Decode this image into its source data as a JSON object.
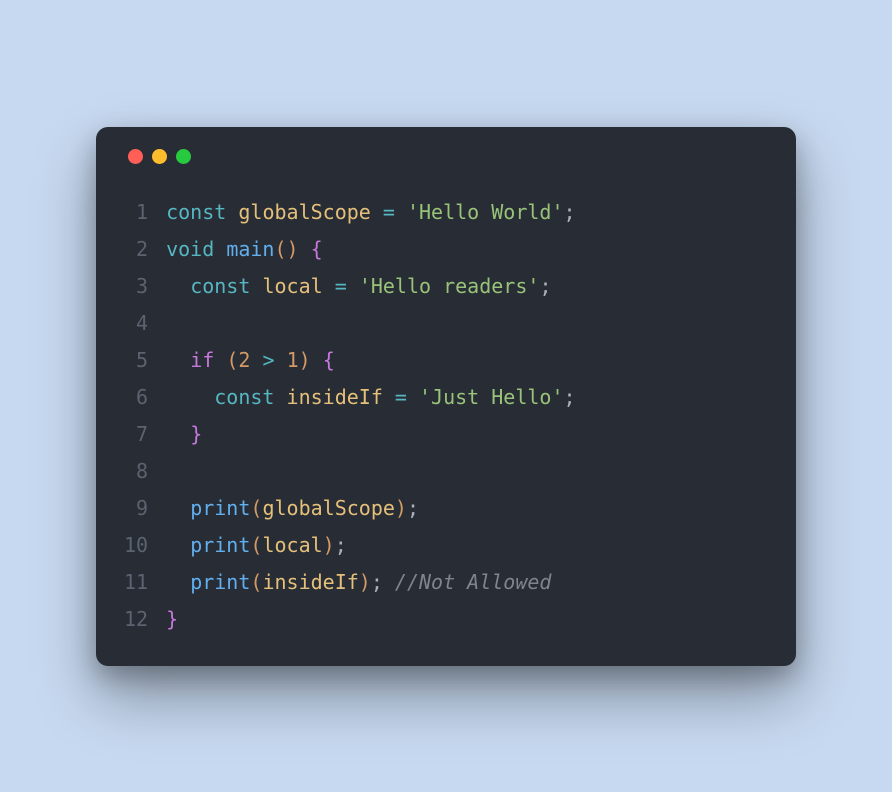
{
  "window": {
    "controls": [
      "close",
      "minimize",
      "maximize"
    ]
  },
  "code": {
    "lineNumbers": [
      "1",
      "2",
      "3",
      "4",
      "5",
      "6",
      "7",
      "8",
      "9",
      "10",
      "11",
      "12"
    ],
    "lines": [
      [
        {
          "cls": "tok-keyword",
          "t": "const"
        },
        {
          "cls": "tok-plain",
          "t": " "
        },
        {
          "cls": "tok-ident",
          "t": "globalScope"
        },
        {
          "cls": "tok-plain",
          "t": " "
        },
        {
          "cls": "tok-op",
          "t": "="
        },
        {
          "cls": "tok-plain",
          "t": " "
        },
        {
          "cls": "tok-string",
          "t": "'Hello World'"
        },
        {
          "cls": "tok-semi",
          "t": ";"
        }
      ],
      [
        {
          "cls": "tok-keyword",
          "t": "void"
        },
        {
          "cls": "tok-plain",
          "t": " "
        },
        {
          "cls": "tok-func",
          "t": "main"
        },
        {
          "cls": "tok-paren",
          "t": "()"
        },
        {
          "cls": "tok-plain",
          "t": " "
        },
        {
          "cls": "tok-brace",
          "t": "{"
        }
      ],
      [
        {
          "cls": "tok-plain",
          "t": "  "
        },
        {
          "cls": "tok-keyword",
          "t": "const"
        },
        {
          "cls": "tok-plain",
          "t": " "
        },
        {
          "cls": "tok-ident",
          "t": "local"
        },
        {
          "cls": "tok-plain",
          "t": " "
        },
        {
          "cls": "tok-op",
          "t": "="
        },
        {
          "cls": "tok-plain",
          "t": " "
        },
        {
          "cls": "tok-string",
          "t": "'Hello readers'"
        },
        {
          "cls": "tok-semi",
          "t": ";"
        }
      ],
      [
        {
          "cls": "tok-plain",
          "t": ""
        }
      ],
      [
        {
          "cls": "tok-plain",
          "t": "  "
        },
        {
          "cls": "tok-type",
          "t": "if"
        },
        {
          "cls": "tok-plain",
          "t": " "
        },
        {
          "cls": "tok-paren",
          "t": "("
        },
        {
          "cls": "tok-num",
          "t": "2"
        },
        {
          "cls": "tok-plain",
          "t": " "
        },
        {
          "cls": "tok-op",
          "t": ">"
        },
        {
          "cls": "tok-plain",
          "t": " "
        },
        {
          "cls": "tok-num",
          "t": "1"
        },
        {
          "cls": "tok-paren",
          "t": ")"
        },
        {
          "cls": "tok-plain",
          "t": " "
        },
        {
          "cls": "tok-brace",
          "t": "{"
        }
      ],
      [
        {
          "cls": "tok-plain",
          "t": "    "
        },
        {
          "cls": "tok-keyword",
          "t": "const"
        },
        {
          "cls": "tok-plain",
          "t": " "
        },
        {
          "cls": "tok-ident",
          "t": "insideIf"
        },
        {
          "cls": "tok-plain",
          "t": " "
        },
        {
          "cls": "tok-op",
          "t": "="
        },
        {
          "cls": "tok-plain",
          "t": " "
        },
        {
          "cls": "tok-string",
          "t": "'Just Hello'"
        },
        {
          "cls": "tok-semi",
          "t": ";"
        }
      ],
      [
        {
          "cls": "tok-plain",
          "t": "  "
        },
        {
          "cls": "tok-brace",
          "t": "}"
        }
      ],
      [
        {
          "cls": "tok-plain",
          "t": ""
        }
      ],
      [
        {
          "cls": "tok-plain",
          "t": "  "
        },
        {
          "cls": "tok-func",
          "t": "print"
        },
        {
          "cls": "tok-paren",
          "t": "("
        },
        {
          "cls": "tok-ident",
          "t": "globalScope"
        },
        {
          "cls": "tok-paren",
          "t": ")"
        },
        {
          "cls": "tok-semi",
          "t": ";"
        }
      ],
      [
        {
          "cls": "tok-plain",
          "t": "  "
        },
        {
          "cls": "tok-func",
          "t": "print"
        },
        {
          "cls": "tok-paren",
          "t": "("
        },
        {
          "cls": "tok-ident",
          "t": "local"
        },
        {
          "cls": "tok-paren",
          "t": ")"
        },
        {
          "cls": "tok-semi",
          "t": ";"
        }
      ],
      [
        {
          "cls": "tok-plain",
          "t": "  "
        },
        {
          "cls": "tok-func",
          "t": "print"
        },
        {
          "cls": "tok-paren",
          "t": "("
        },
        {
          "cls": "tok-ident",
          "t": "insideIf"
        },
        {
          "cls": "tok-paren",
          "t": ")"
        },
        {
          "cls": "tok-semi",
          "t": ";"
        },
        {
          "cls": "tok-plain",
          "t": " "
        },
        {
          "cls": "tok-comment",
          "t": "//Not Allowed"
        }
      ],
      [
        {
          "cls": "tok-brace",
          "t": "}"
        }
      ]
    ]
  }
}
